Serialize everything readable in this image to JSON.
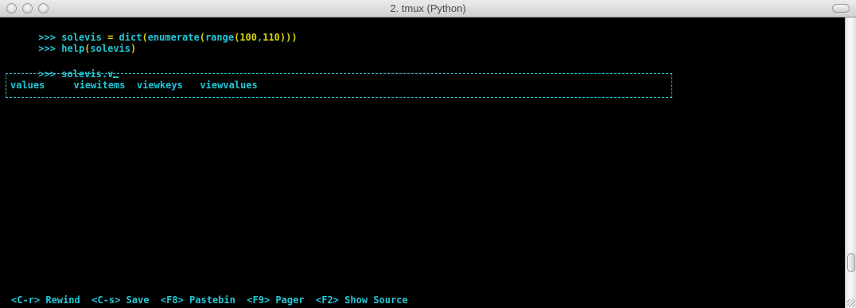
{
  "window": {
    "title": "2. tmux (Python)"
  },
  "terminal": {
    "line1": {
      "prompt": ">>>",
      "code": [
        {
          "t": "solevis",
          "cls": "ident"
        },
        {
          "t": " = ",
          "cls": "kw"
        },
        {
          "t": "dict",
          "cls": "ident"
        },
        {
          "t": "(",
          "cls": "paren"
        },
        {
          "t": "enumerate",
          "cls": "ident"
        },
        {
          "t": "(",
          "cls": "paren"
        },
        {
          "t": "range",
          "cls": "ident"
        },
        {
          "t": "(",
          "cls": "paren"
        },
        {
          "t": "100",
          "cls": "num"
        },
        {
          "t": ",",
          "cls": "ident"
        },
        {
          "t": "110",
          "cls": "num"
        },
        {
          "t": ")))",
          "cls": "paren"
        }
      ]
    },
    "line2": {
      "prompt": ">>>",
      "code": [
        {
          "t": "help",
          "cls": "ident"
        },
        {
          "t": "(",
          "cls": "paren"
        },
        {
          "t": "solevis",
          "cls": "ident"
        },
        {
          "t": ")",
          "cls": "paren"
        }
      ]
    },
    "line3": {
      "prompt": ">>>",
      "text": "solevis.v"
    }
  },
  "completion": {
    "items": [
      "values",
      "viewitems",
      "viewkeys",
      "viewvalues"
    ]
  },
  "statusbar": [
    {
      "key": "<C-r>",
      "label": "Rewind"
    },
    {
      "key": "<C-s>",
      "label": "Save"
    },
    {
      "key": "<F8>",
      "label": "Pastebin"
    },
    {
      "key": "<F9>",
      "label": "Pager"
    },
    {
      "key": "<F2>",
      "label": "Show Source"
    }
  ],
  "colors": {
    "cyan": "#22c7d6",
    "yellow": "#d4d400",
    "background": "#000000"
  }
}
